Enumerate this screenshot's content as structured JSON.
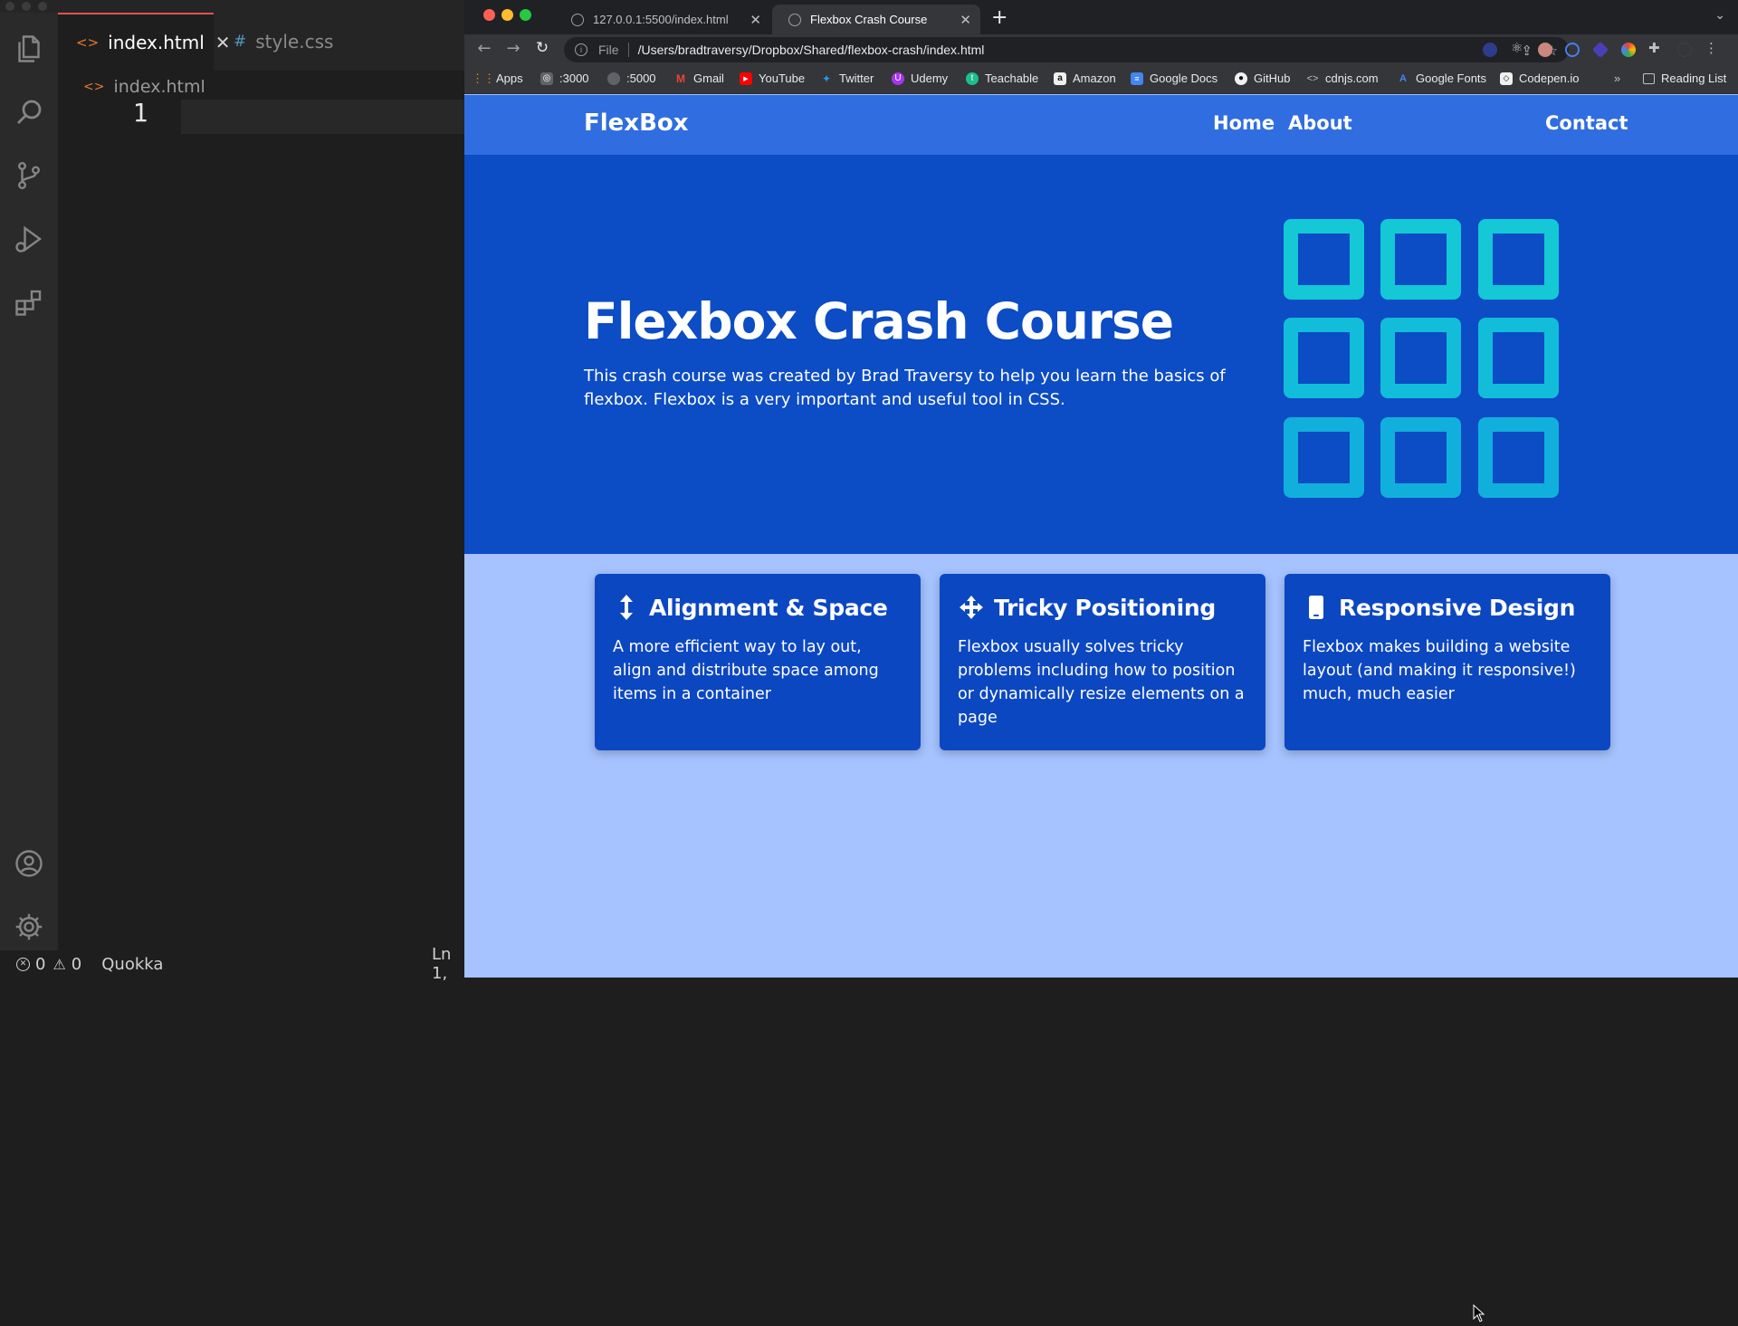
{
  "vscode": {
    "tabs": [
      {
        "name": "index.html",
        "active": true,
        "icon": "html-icon"
      },
      {
        "name": "style.css",
        "active": false,
        "icon": "css-icon"
      }
    ],
    "breadcrumb": "index.html",
    "line_number": "1",
    "activity_icons": [
      "files-icon",
      "search-icon",
      "source-control-icon",
      "run-debug-icon",
      "extensions-icon",
      "account-icon",
      "settings-gear-icon"
    ],
    "status": {
      "errors": "0",
      "warnings": "0",
      "extension": "Quokka",
      "position": "Ln 1,"
    }
  },
  "browser": {
    "tabs": [
      {
        "title": "127.0.0.1:5500/index.html",
        "active": false
      },
      {
        "title": "Flexbox Crash Course",
        "active": true
      }
    ],
    "address": {
      "scheme_label": "File",
      "url": "/Users/bradtraversy/Dropbox/Shared/flexbox-crash/index.html"
    },
    "bookmarks": [
      {
        "label": "Apps",
        "icon": "apps-grid-icon"
      },
      {
        "label": ":3000",
        "icon": "localhost-icon"
      },
      {
        "label": ":5000",
        "icon": "globe-icon"
      },
      {
        "label": "Gmail",
        "icon": "gmail-icon"
      },
      {
        "label": "YouTube",
        "icon": "youtube-icon"
      },
      {
        "label": "Twitter",
        "icon": "twitter-icon"
      },
      {
        "label": "Udemy",
        "icon": "udemy-icon"
      },
      {
        "label": "Teachable",
        "icon": "teachable-icon"
      },
      {
        "label": "Amazon",
        "icon": "amazon-icon"
      },
      {
        "label": "Google Docs",
        "icon": "google-docs-icon"
      },
      {
        "label": "GitHub",
        "icon": "github-icon"
      },
      {
        "label": "cdnjs.com",
        "icon": "code-icon"
      },
      {
        "label": "Google Fonts",
        "icon": "google-fonts-icon"
      },
      {
        "label": "Codepen.io",
        "icon": "codepen-icon"
      }
    ],
    "bookmarks_overflow": "»",
    "reading_list": "Reading List"
  },
  "site": {
    "logo": "FlexBox",
    "nav": [
      "Home",
      "About",
      "Contact"
    ],
    "hero": {
      "title": "Flexbox Crash Course",
      "text": "This crash course was created by Brad Traversy to help you learn the basics of flexbox. Flexbox is a very important and useful tool in CSS."
    },
    "features": [
      {
        "icon": "arrows-vertical-icon",
        "title": "Alignment & Space",
        "text": "A more efficient way to lay out, align and distribute space among items in a container"
      },
      {
        "icon": "arrows-move-icon",
        "title": "Tricky Positioning",
        "text": "Flexbox usually solves tricky problems including how to position or dynamically resize elements on a page"
      },
      {
        "icon": "mobile-phone-icon",
        "title": "Responsive Design",
        "text": "Flexbox makes building a website layout (and making it responsive!) much, much easier"
      }
    ]
  },
  "colors": {
    "site_nav": "#306de0",
    "hero": "#0c4cc5",
    "features_bg": "#a6c3ff",
    "card": "#0c47c2",
    "grid_box": "#14c8d6"
  }
}
